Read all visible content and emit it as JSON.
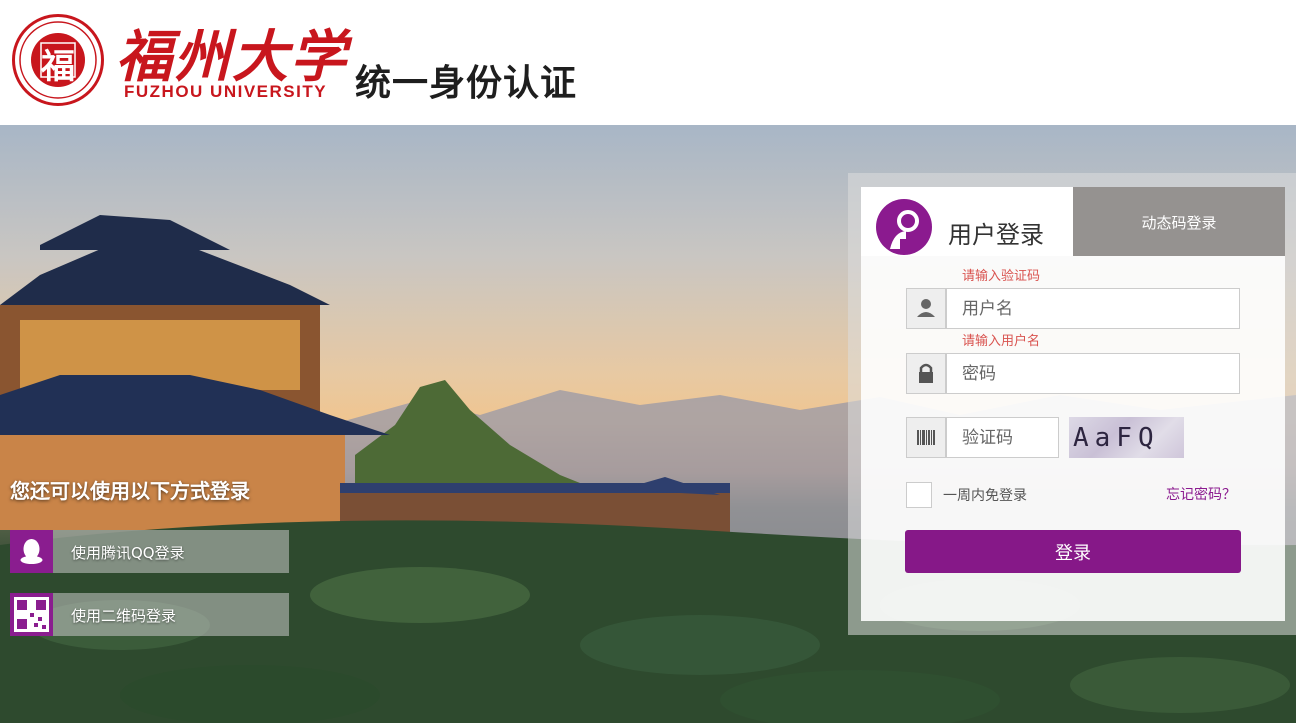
{
  "header": {
    "seal_text": "福",
    "seal_ring_text": "FUZHOU UNIVERSITY",
    "university_cn": "福州大学",
    "university_en": "FUZHOU UNIVERSITY",
    "system_title": "统一身份认证"
  },
  "quick_login": {
    "title": "您还可以使用以下方式登录",
    "options": [
      {
        "label": "使用腾讯QQ登录",
        "icon": "qq-icon"
      },
      {
        "label": "使用二维码登录",
        "icon": "qr-code-icon"
      }
    ]
  },
  "login_panel": {
    "tab_user": "用户登录",
    "tab_dynamic": "动态码登录",
    "error_captcha": "请输入验证码",
    "error_username": "请输入用户名",
    "username_placeholder": "用户名",
    "password_placeholder": "密码",
    "captcha_placeholder": "验证码",
    "captcha_text": "AaFQ",
    "remember_label": "一周内免登录",
    "forgot_label": "忘记密码？",
    "submit_label": "登录"
  },
  "colors": {
    "brand_red": "#c8161d",
    "accent_purple": "#861888",
    "tab_inactive": "#959290"
  }
}
